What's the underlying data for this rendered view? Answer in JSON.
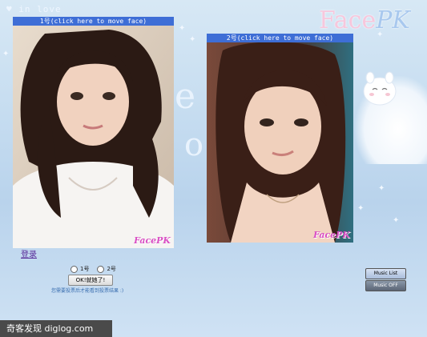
{
  "background": {
    "tagline": "♥ in love",
    "logo_face": "Face",
    "logo_pk": "PK"
  },
  "photos": [
    {
      "header": "1号(click here to move face)",
      "watermark": "FacePK"
    },
    {
      "header": "2号(click here to move face)",
      "watermark": "FacePK"
    }
  ],
  "login_label": "登录",
  "vote": {
    "option1": "1号",
    "option2": "2号",
    "button_label": "OK!就她了!",
    "note": "您需要投票后才能看到投票结果 :)"
  },
  "music": {
    "list_label": "Music List",
    "off_label": "Music OFF"
  },
  "site_badge": "奇客发现 diglog.com",
  "colors": {
    "header_bar": "#3e6ed6",
    "background": "#c5dcf0",
    "watermark": "#d94fc4"
  }
}
